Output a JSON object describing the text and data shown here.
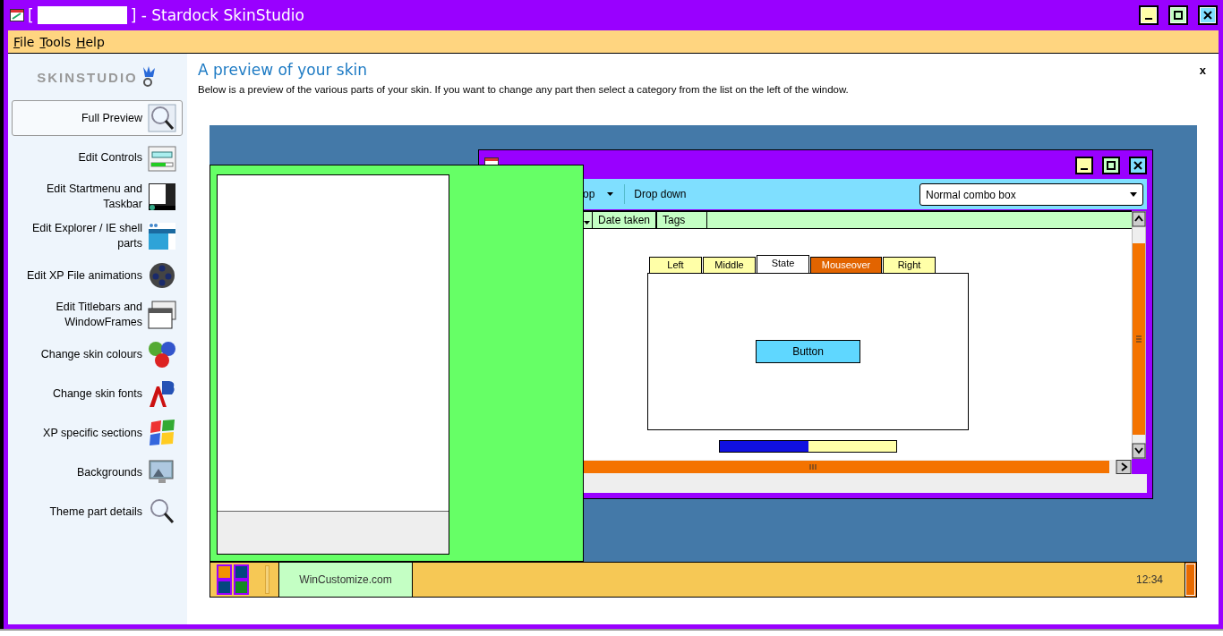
{
  "window": {
    "title_start": "[",
    "title_end": "] - Stardock SkinStudio"
  },
  "menu": [
    {
      "label": "File"
    },
    {
      "label": "Tools"
    },
    {
      "label": "Help"
    }
  ],
  "sidebar": {
    "logo": "SKINSTUDIO",
    "items": [
      {
        "label": "Full Preview",
        "selected": true
      },
      {
        "label": "Edit Controls",
        "selected": false
      },
      {
        "label": "Edit Startmenu and Taskbar",
        "selected": false
      },
      {
        "label": "Edit Explorer / IE shell parts",
        "selected": false
      },
      {
        "label": "Edit XP File animations",
        "selected": false
      },
      {
        "label": "Edit Titlebars and WindowFrames",
        "selected": false
      },
      {
        "label": "Change skin colours",
        "selected": false
      },
      {
        "label": "Change skin fonts",
        "selected": false
      },
      {
        "label": "XP specific sections",
        "selected": false
      },
      {
        "label": "Backgrounds",
        "selected": false
      },
      {
        "label": "Theme part details",
        "selected": false
      }
    ]
  },
  "content": {
    "heading": "A preview of your skin",
    "description": "Below is a preview of the various parts of your skin.  If you want to change any part then select a category from the list on the left of the window.",
    "close": "x"
  },
  "preview": {
    "window": {
      "toolbar": [
        {
          "label": "op",
          "kind": "dropdown"
        },
        {
          "label": "Drop down",
          "kind": "button"
        }
      ],
      "combo": "Normal combo box",
      "columns": [
        "Date taken",
        "Tags"
      ],
      "tabs": [
        {
          "label": "Left",
          "selected": false,
          "hovered": false
        },
        {
          "label": "Middle",
          "selected": false,
          "hovered": false
        },
        {
          "label": "State",
          "selected": true,
          "hovered": false
        },
        {
          "label": "Mouseover",
          "selected": false,
          "hovered": true
        },
        {
          "label": "Right",
          "selected": false,
          "hovered": false
        }
      ],
      "button": "Button",
      "progress": {
        "level": 0.5
      }
    },
    "taskbar": {
      "task": "WinCustomize.com",
      "clock": "12:34"
    }
  }
}
